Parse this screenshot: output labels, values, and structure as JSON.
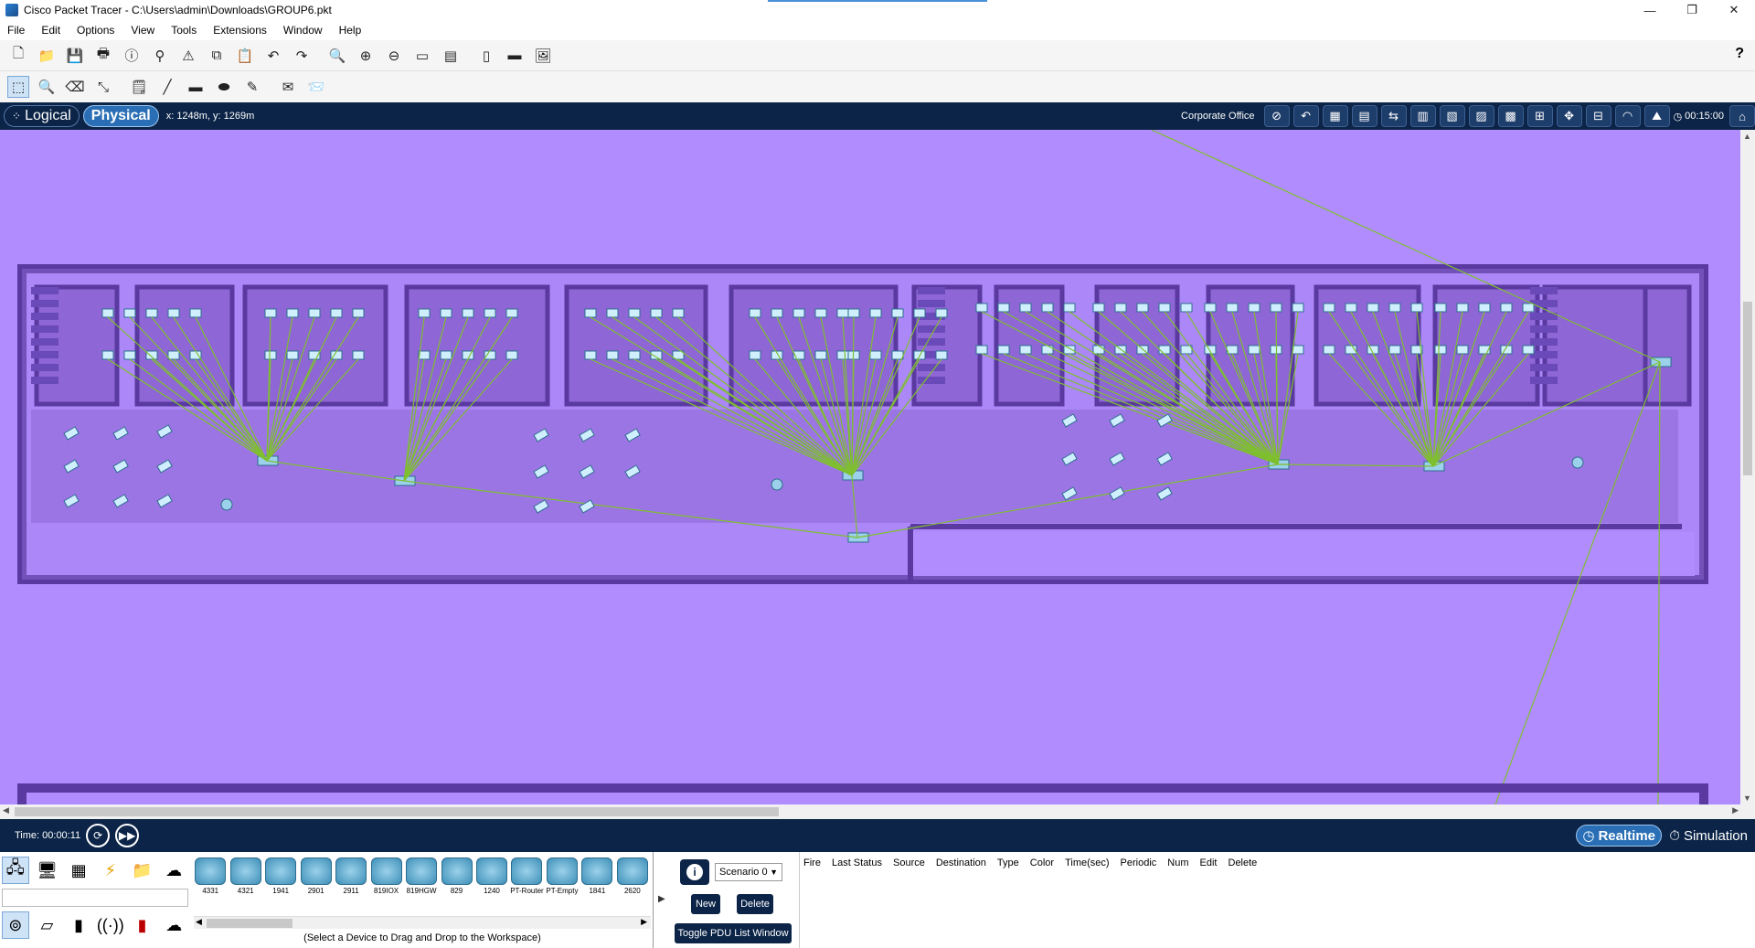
{
  "window": {
    "title": "Cisco Packet Tracer - C:\\Users\\admin\\Downloads\\GROUP6.pkt",
    "minimize": "—",
    "restore": "❐",
    "close": "✕"
  },
  "menu": [
    "File",
    "Edit",
    "Options",
    "View",
    "Tools",
    "Extensions",
    "Window",
    "Help"
  ],
  "workspace_header": {
    "logical_label": "Logical",
    "physical_label": "Physical",
    "coordinates": "x: 1248m, y: 1269m",
    "location": "Corporate Office",
    "clock": "00:15:00"
  },
  "timebar": {
    "time": "Time: 00:00:11",
    "realtime_label": "Realtime",
    "simulation_label": "Simulation"
  },
  "devices": {
    "models": [
      "4331",
      "4321",
      "1941",
      "2901",
      "2911",
      "819IOX",
      "819HGW",
      "829",
      "1240",
      "PT-Router",
      "PT-Empty",
      "1841",
      "2620"
    ],
    "hint": "(Select a Device to Drag and Drop to the Workspace)"
  },
  "pdu": {
    "scenario": "Scenario 0",
    "new_label": "New",
    "delete_label": "Delete",
    "toggle_label": "Toggle PDU List Window",
    "columns": [
      "Fire",
      "Last Status",
      "Source",
      "Destination",
      "Type",
      "Color",
      "Time(sec)",
      "Periodic",
      "Num",
      "Edit",
      "Delete"
    ]
  },
  "colors": {
    "workspace_bg": "#b18cff",
    "wall": "#5a3aa0",
    "room": "#8e66d6",
    "header_bg": "#0b2447",
    "link": "#7fbf2f"
  }
}
